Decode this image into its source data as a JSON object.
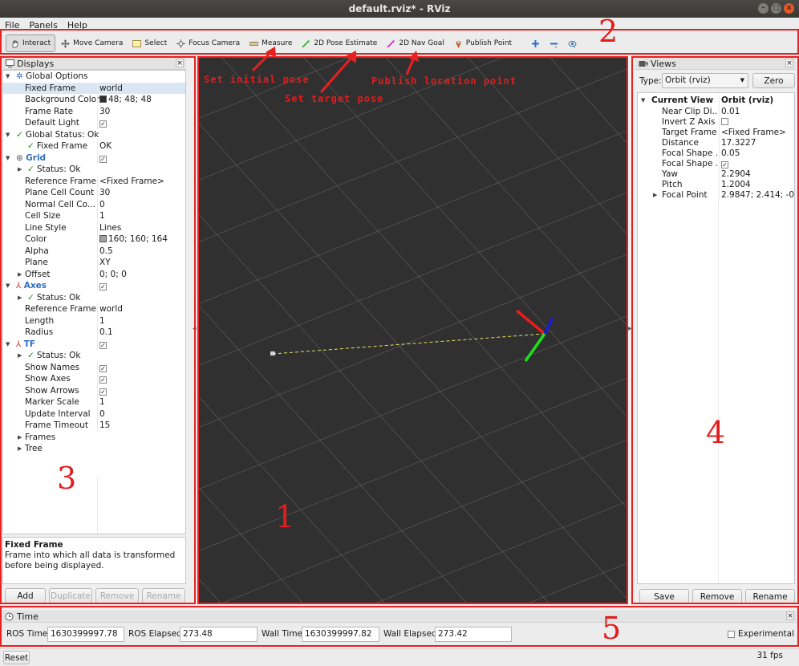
{
  "window": {
    "title": "default.rviz* - RViz"
  },
  "menu": {
    "file": "File",
    "panels": "Panels",
    "help": "Help"
  },
  "toolbar": {
    "interact": "Interact",
    "move_camera": "Move Camera",
    "select": "Select",
    "focus_camera": "Focus Camera",
    "measure": "Measure",
    "pose_estimate": "2D Pose Estimate",
    "nav_goal": "2D Nav Goal",
    "publish_point": "Publish Point"
  },
  "annotations": {
    "n1": "1",
    "n2": "2",
    "n3": "3",
    "n4": "4",
    "n5": "5",
    "set_initial_pose": "Set initial pose",
    "set_target_pose": "Set target pose",
    "publish_location": "Publish location point"
  },
  "displays": {
    "title": "Displays",
    "rows": {
      "global_options": "Global Options",
      "fixed_frame_k": "Fixed Frame",
      "fixed_frame_v": "world",
      "bg_color_k": "Background Color",
      "bg_color_v": "48; 48; 48",
      "frame_rate_k": "Frame Rate",
      "frame_rate_v": "30",
      "default_light_k": "Default Light",
      "global_status": "Global Status: Ok",
      "gs_fixed_frame_k": "Fixed Frame",
      "gs_fixed_frame_v": "OK",
      "grid": "Grid",
      "grid_status": "Status: Ok",
      "ref_frame_k": "Reference Frame",
      "ref_frame_v": "<Fixed Frame>",
      "plane_cell_count_k": "Plane Cell Count",
      "plane_cell_count_v": "30",
      "normal_cell_k": "Normal Cell Co...",
      "normal_cell_v": "0",
      "cell_size_k": "Cell Size",
      "cell_size_v": "1",
      "line_style_k": "Line Style",
      "line_style_v": "Lines",
      "color_k": "Color",
      "color_v": "160; 160; 164",
      "alpha_k": "Alpha",
      "alpha_v": "0.5",
      "plane_k": "Plane",
      "plane_v": "XY",
      "offset_k": "Offset",
      "offset_v": "0; 0; 0",
      "axes": "Axes",
      "axes_status": "Status: Ok",
      "axes_ref_k": "Reference Frame",
      "axes_ref_v": "world",
      "length_k": "Length",
      "length_v": "1",
      "radius_k": "Radius",
      "radius_v": "0.1",
      "tf": "TF",
      "tf_status": "Status: Ok",
      "show_names_k": "Show Names",
      "show_axes_k": "Show Axes",
      "show_arrows_k": "Show Arrows",
      "marker_scale_k": "Marker Scale",
      "marker_scale_v": "1",
      "update_interval_k": "Update Interval",
      "update_interval_v": "0",
      "frame_timeout_k": "Frame Timeout",
      "frame_timeout_v": "15",
      "frames": "Frames",
      "tree": "Tree"
    },
    "desc_title": "Fixed Frame",
    "desc_text": "Frame into which all data is transformed before being displayed.",
    "buttons": {
      "add": "Add",
      "duplicate": "Duplicate",
      "remove": "Remove",
      "rename": "Rename"
    }
  },
  "views": {
    "title": "Views",
    "type_label": "Type:",
    "type_value": "Orbit (rviz)",
    "zero": "Zero",
    "rows": {
      "current_view_k": "Current View",
      "current_view_v": "Orbit (rviz)",
      "near_clip_k": "Near Clip Di...",
      "near_clip_v": "0.01",
      "invert_z_k": "Invert Z Axis",
      "target_frame_k": "Target Frame",
      "target_frame_v": "<Fixed Frame>",
      "distance_k": "Distance",
      "distance_v": "17.3227",
      "focal_shape1_k": "Focal Shape ...",
      "focal_shape1_v": "0.05",
      "focal_shape2_k": "Focal Shape ...",
      "yaw_k": "Yaw",
      "yaw_v": "2.2904",
      "pitch_k": "Pitch",
      "pitch_v": "1.2004",
      "focal_point_k": "Focal Point",
      "focal_point_v": "2.9847; 2.414; -0...."
    },
    "buttons": {
      "save": "Save",
      "remove": "Remove",
      "rename": "Rename"
    }
  },
  "time": {
    "title": "Time",
    "ros_time_label": "ROS Time:",
    "ros_time": "1630399997.78",
    "ros_elapsed_label": "ROS Elapsed:",
    "ros_elapsed": "273.48",
    "wall_time_label": "Wall Time:",
    "wall_time": "1630399997.82",
    "wall_elapsed_label": "Wall Elapsed:",
    "wall_elapsed": "273.42",
    "experimental": "Experimental"
  },
  "status": {
    "reset": "Reset",
    "fps": "31 fps"
  },
  "colors": {
    "background_3d": "#303030",
    "annotation": "#e82020",
    "grid": "#a0a0a4"
  }
}
